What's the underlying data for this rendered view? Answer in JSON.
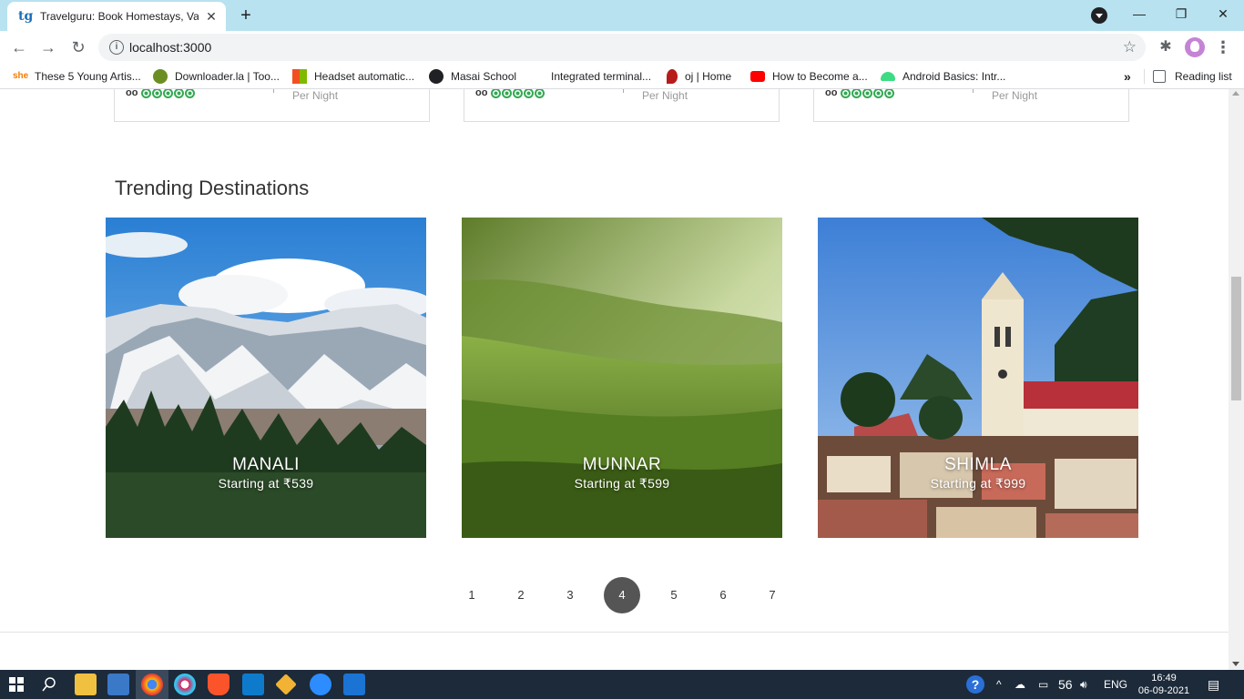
{
  "browser": {
    "tab_title": "Travelguru: Book Homestays, Vac",
    "favicon": "tg",
    "url": "localhost:3000"
  },
  "bookmarks": [
    {
      "label": "These 5 Young Artis...",
      "icon": "she-icon",
      "color": "#f57c00"
    },
    {
      "label": "Downloader.la | Too...",
      "icon": "downloader-icon",
      "color": "#6b8e23"
    },
    {
      "label": "Headset automatic...",
      "icon": "microsoft-icon",
      "color": "#f25022"
    },
    {
      "label": "Masai School",
      "icon": "globe-icon",
      "color": "#202124"
    },
    {
      "label": "Integrated terminal...",
      "icon": "blank-icon",
      "color": "#ffffff"
    },
    {
      "label": "oj | Home",
      "icon": "balloon-icon",
      "color": "#b71c1c"
    },
    {
      "label": "How to Become a...",
      "icon": "youtube-icon",
      "color": "#ff0000"
    },
    {
      "label": "Android Basics: Intr...",
      "icon": "android-icon",
      "color": "#3ddc84"
    }
  ],
  "reading_list": "Reading list",
  "hotel_cards": [
    {
      "per_night": "Per Night"
    },
    {
      "per_night": "Per Night"
    },
    {
      "per_night": "Per Night"
    }
  ],
  "section_title": "Trending Destinations",
  "destinations": [
    {
      "name": "MANALI",
      "price": "Starting at ₹539"
    },
    {
      "name": "MUNNAR",
      "price": "Starting at ₹599"
    },
    {
      "name": "SHIMLA",
      "price": "Starting at ₹999"
    }
  ],
  "pagination": {
    "pages": [
      "1",
      "2",
      "3",
      "4",
      "5",
      "6",
      "7"
    ],
    "active": "4"
  },
  "taskbar": {
    "temperature": "56",
    "language": "ENG",
    "time": "16:49",
    "date": "06-09-2021"
  }
}
